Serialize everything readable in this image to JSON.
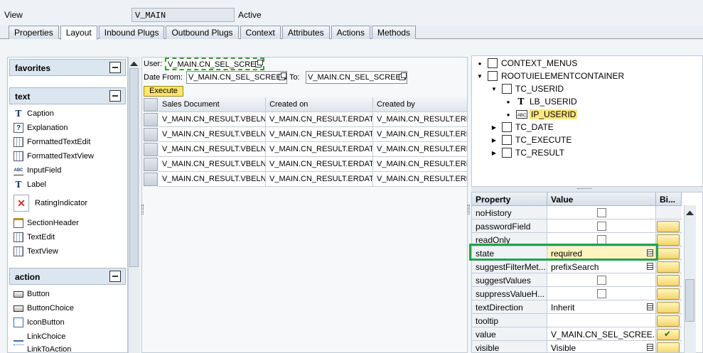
{
  "header": {
    "view_label": "View",
    "view_name": "V_MAIN",
    "status": "Active"
  },
  "tabs": [
    {
      "label": "Properties",
      "active": false
    },
    {
      "label": "Layout",
      "active": true
    },
    {
      "label": "Inbound Plugs",
      "active": false
    },
    {
      "label": "Outbound Plugs",
      "active": false
    },
    {
      "label": "Context",
      "active": false
    },
    {
      "label": "Attributes",
      "active": false
    },
    {
      "label": "Actions",
      "active": false
    },
    {
      "label": "Methods",
      "active": false
    }
  ],
  "palette": {
    "groups": {
      "favorites": "favorites",
      "text": "text",
      "action": "action"
    },
    "text_items": [
      "Caption",
      "Explanation",
      "FormattedTextEdit",
      "FormattedTextView",
      "InputField",
      "Label",
      "RatingIndicator",
      "SectionHeader",
      "TextEdit",
      "TextView"
    ],
    "action_items": [
      "Button",
      "ButtonChoice",
      "IconButton",
      "LinkChoice",
      "LinkToAction"
    ],
    "icons": {
      "caption": "T",
      "explanation": "?",
      "input_field": "ABC",
      "label": "T",
      "rating": "✕"
    }
  },
  "preview": {
    "user_label": "User:",
    "user_value": "V_MAIN.CN_SEL_SCREE",
    "date_from_label": "Date From:",
    "date_from_value": "V_MAIN.CN_SEL_SCREEN",
    "to_label": "To:",
    "to_value": "V_MAIN.CN_SEL_SCREEN",
    "execute_label": "Execute",
    "columns": [
      "Sales Document",
      "Created on",
      "Created by"
    ],
    "rows": [
      [
        "V_MAIN.CN_RESULT.VBELN",
        "V_MAIN.CN_RESULT.ERDAT",
        "V_MAIN.CN_RESULT.ERNAM"
      ],
      [
        "V_MAIN.CN_RESULT.VBELN",
        "V_MAIN.CN_RESULT.ERDAT",
        "V_MAIN.CN_RESULT.ERNAM"
      ],
      [
        "V_MAIN.CN_RESULT.VBELN",
        "V_MAIN.CN_RESULT.ERDAT",
        "V_MAIN.CN_RESULT.ERNAM"
      ],
      [
        "V_MAIN.CN_RESULT.VBELN",
        "V_MAIN.CN_RESULT.ERDAT",
        "V_MAIN.CN_RESULT.ERNAM"
      ],
      [
        "V_MAIN.CN_RESULT.VBELN",
        "V_MAIN.CN_RESULT.ERDAT",
        "V_MAIN.CN_RESULT.ERNAM"
      ]
    ]
  },
  "tree": {
    "context_menus": "CONTEXT_MENUS",
    "root": "ROOTUIELEMENTCONTAINER",
    "tc_userid": "TC_USERID",
    "lb_userid": "LB_USERID",
    "ip_userid": "IP_USERID",
    "tc_date": "TC_DATE",
    "tc_execute": "TC_EXECUTE",
    "tc_result": "TC_RESULT",
    "field_icon_text": "ABC",
    "label_icon_text": "T"
  },
  "properties": {
    "headers": {
      "property": "Property",
      "value": "Value",
      "binding": "Bi..."
    },
    "rows": [
      {
        "name": "noHistory",
        "value": ""
      },
      {
        "name": "passwordField",
        "value": ""
      },
      {
        "name": "readOnly",
        "value": ""
      },
      {
        "name": "state",
        "value": "required"
      },
      {
        "name": "suggestFilterMet...",
        "value": "prefixSearch"
      },
      {
        "name": "suggestValues",
        "value": ""
      },
      {
        "name": "suppressValueH...",
        "value": ""
      },
      {
        "name": "textDirection",
        "value": "Inherit"
      },
      {
        "name": "tooltip",
        "value": ""
      },
      {
        "name": "value",
        "value": "V_MAIN.CN_SEL_SCREE..."
      },
      {
        "name": "visible",
        "value": "Visible"
      }
    ]
  }
}
